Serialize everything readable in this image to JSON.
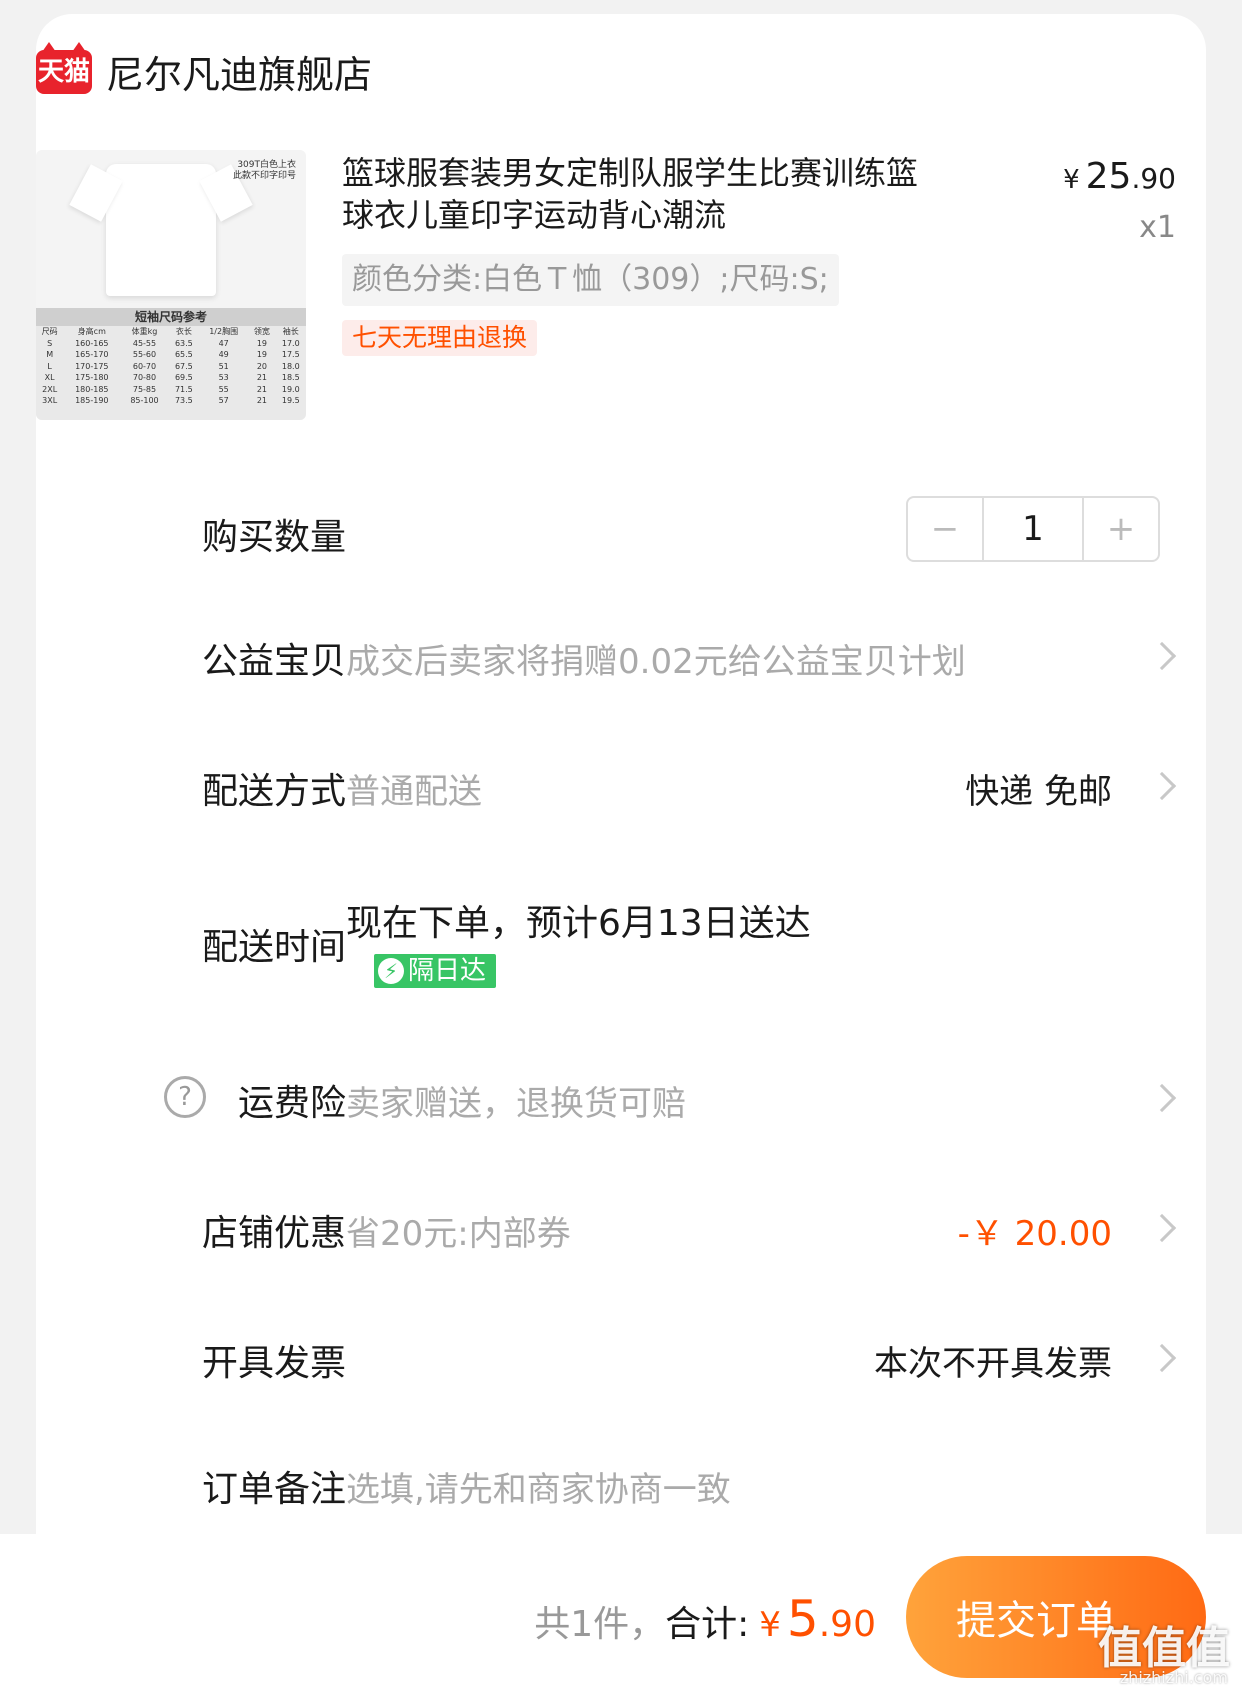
{
  "shop": {
    "logo_text": "天猫",
    "name": "尼尔凡迪旗舰店"
  },
  "product": {
    "image_tag_lines": [
      "309T白色上衣",
      "此款不印字印号"
    ],
    "size_table": {
      "title": "短袖尺码参考",
      "headers": [
        "尺码",
        "身高cm",
        "体重kg",
        "衣长",
        "1/2胸围",
        "领宽",
        "袖长"
      ],
      "rows": [
        [
          "S",
          "160-165",
          "45-55",
          "63.5",
          "47",
          "19",
          "17.0"
        ],
        [
          "M",
          "165-170",
          "55-60",
          "65.5",
          "49",
          "19",
          "17.5"
        ],
        [
          "L",
          "170-175",
          "60-70",
          "67.5",
          "51",
          "20",
          "18.0"
        ],
        [
          "XL",
          "175-180",
          "70-80",
          "69.5",
          "53",
          "21",
          "18.5"
        ],
        [
          "2XL",
          "180-185",
          "75-85",
          "71.5",
          "55",
          "21",
          "19.0"
        ],
        [
          "3XL",
          "185-190",
          "85-100",
          "73.5",
          "57",
          "21",
          "19.5"
        ]
      ]
    },
    "title": "篮球服套装男女定制队服学生比赛训练篮球衣儿童印字运动背心潮流",
    "price_currency": "¥",
    "price_int": "25",
    "price_dec": ".90",
    "quantity_label": "x1",
    "sku": "颜色分类:白色Ｔ恤（309）;尺码:S;",
    "return_tag": "七天无理由退换"
  },
  "rows": {
    "quantity": {
      "label": "购买数量",
      "value": "1",
      "minus": "−",
      "plus": "+"
    },
    "charity": {
      "label": "公益宝贝",
      "value": "成交后卖家将捐赠0.02元给公益宝贝计划"
    },
    "delivery": {
      "label": "配送方式",
      "value": "普通配送",
      "right": "快递 免邮"
    },
    "delivery_time": {
      "label": "配送时间",
      "value": "现在下单，预计6月13日送达",
      "badge": "隔日达",
      "badge_icon": "⚡"
    },
    "shipping_insurance": {
      "label": "运费险",
      "help_icon": "?",
      "value": "卖家赠送，退换货可赔"
    },
    "shop_discount": {
      "label": "店铺优惠",
      "value": "省20元:内部券",
      "right": "-￥ 20.00"
    },
    "invoice": {
      "label": "开具发票",
      "right": "本次不开具发票"
    },
    "note": {
      "label": "订单备注",
      "placeholder": "选填,请先和商家协商一致"
    }
  },
  "footer": {
    "count_text": "共1件，",
    "total_label": "合计:",
    "currency": "¥",
    "total_int": "5",
    "total_dec": ".90",
    "submit_label": "提交订单",
    "watermark": "值值值",
    "watermark_sub": "zhizhizhi.com"
  },
  "colors": {
    "accent": "#ff5000",
    "tmall_red": "#e8232c",
    "green_badge": "#38c565"
  }
}
